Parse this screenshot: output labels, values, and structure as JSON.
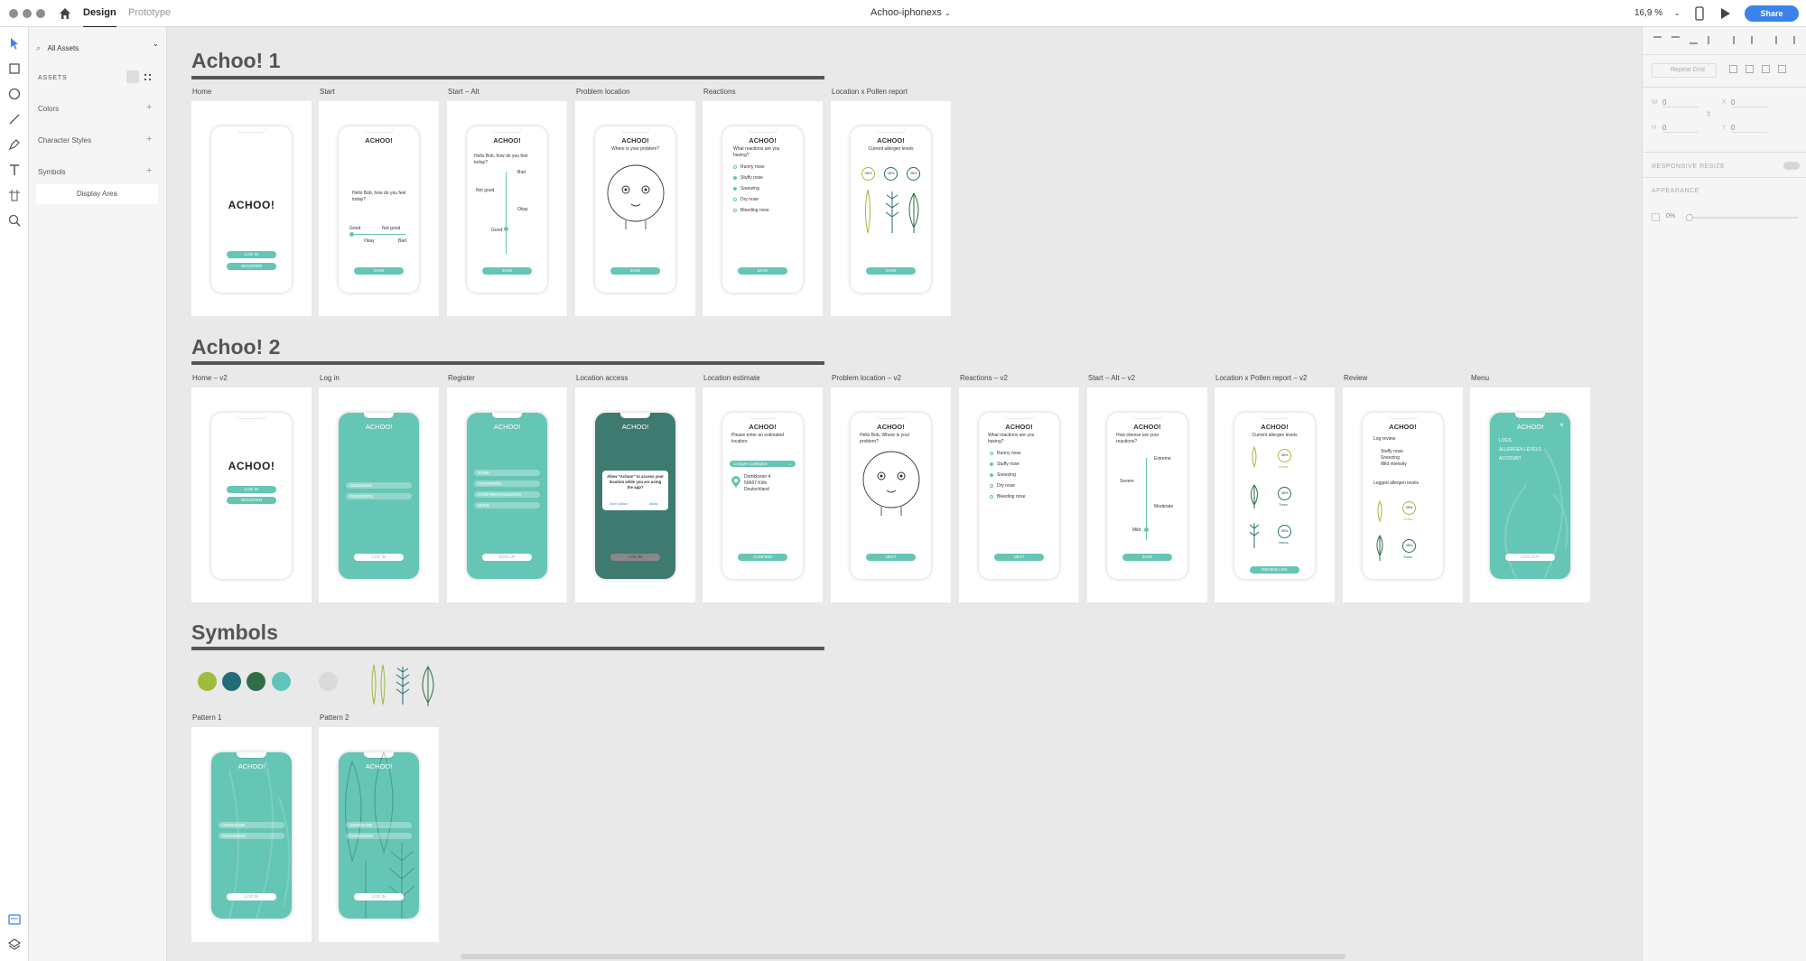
{
  "app": {
    "doc_title": "Achoo-iphonexs",
    "tabs": [
      "Design",
      "Prototype"
    ],
    "zoom": "16,9 %",
    "share_label": "Share"
  },
  "assets": {
    "filter": "All Assets",
    "heading": "ASSETS",
    "colors": "Colors",
    "character_styles": "Character Styles",
    "symbols": "Symbols",
    "display_area": "Display Area"
  },
  "properties": {
    "repeat_grid": "Repeat Grid",
    "w_label": "W",
    "w": "0",
    "h_label": "H",
    "h": "0",
    "x_label": "X",
    "x": "0",
    "y_label": "Y",
    "y": "0",
    "responsive_resize": "RESPONSIVE RESIZE",
    "appearance": "APPEARANCE",
    "opacity": "0%"
  },
  "colors": {
    "teal": "#65c6b5",
    "dark_teal": "#3e7a70"
  },
  "sections": {
    "s1": {
      "title": "Achoo! 1",
      "artboards": [
        "Home",
        "Start",
        "Start – Alt",
        "Problem location",
        "Reactions",
        "Location x Pollen report"
      ]
    },
    "s2": {
      "title": "Achoo! 2",
      "artboards": [
        "Home – v2",
        "Log in",
        "Register",
        "Location access",
        "Location estimate",
        "Problem location – v2",
        "Reactions – v2",
        "Start – Alt – v2",
        "Location x Pollen report – v2",
        "Review",
        "Menu"
      ]
    },
    "s3": {
      "title": "Symbols",
      "swatches": [
        "#9ebb3e",
        "#226c75",
        "#2e6e44",
        "#5fc5bb",
        "#d9d9d9"
      ],
      "artboards": [
        "Pattern 1",
        "Pattern 2"
      ]
    }
  },
  "screens": {
    "logo": "ACHOO!",
    "login": "LOG IN",
    "register": "REGISTER",
    "save": "SAVE",
    "next": "NEXT",
    "confirm": "CONFIRM",
    "sign_up": "SIGN UP",
    "log_out": "LOG OUT",
    "review_log": "REVIEW LOG",
    "username": "USERNAME",
    "password": "PASSWORD",
    "name": "NAME",
    "confirm_password": "CONFIRM PASSWORD",
    "email": "EMAIL",
    "hello": "Hello Bob, how do you feel today?",
    "good": "Good",
    "not_good": "Not good",
    "okay": "Okay",
    "bad": "Bad",
    "where_problem": "Where is your problem?",
    "hello_where": "Hello Bob, Where is your problem?",
    "what_reactions": "What reactions are you having?",
    "reactions": [
      "Runny nose",
      "Stuffy nose",
      "Sneezing",
      "Dry nose",
      "Bleeding nose"
    ],
    "current_allergen": "Current allergen levels",
    "pct": "35%",
    "allergens": [
      "Grass",
      "Trees",
      "Herbs"
    ],
    "how_intense": "How intense are your reactions?",
    "intensity": [
      "Extreme",
      "Severe",
      "Moderate",
      "Mild"
    ],
    "allow_location": "Allow \"Achoo!\" to access your location while you are using the app?",
    "dont_allow": "Don't Allow",
    "allow": "Allow",
    "enter_location": "Please enter an estimated location.",
    "location_field": "Cologne Cathedral",
    "address": "Domkloster 4 50667 Köln Deutschland",
    "log_review": "Log review",
    "review_items": [
      "Stuffy nose",
      "Sneezing",
      "Mild intensity"
    ],
    "logged_allergen": "Logged allergen levels",
    "menu_items": [
      "LOGS",
      "ALLERGEN LEVELS",
      "ACCOUNT"
    ]
  }
}
